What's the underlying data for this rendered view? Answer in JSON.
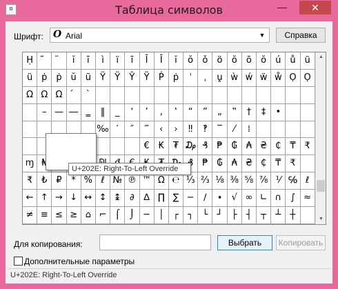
{
  "window": {
    "title": "Таблица символов",
    "app_icon": "¤",
    "minimize_glyph": "—",
    "close_glyph": "✕",
    "accent_color": "#e86a9c",
    "close_color": "#c7474e"
  },
  "font": {
    "label": "Шрифт:",
    "icon_glyph": "O",
    "value": "Arial",
    "dropdown_glyph": "▼"
  },
  "help_button": "Справка",
  "grid": {
    "cells": [
      "Ḥ",
      "̃",
      "̈",
      "ĭ",
      "ī",
      "ì",
      "ï",
      "ī",
      "Ĭ",
      "Ĭ",
      "ĭ",
      "ŏ",
      "ǒ",
      "ö",
      "ŏ",
      "ō",
      "ŏ",
      "ú",
      "ů",
      "ü",
      "ü",
      "ṗ",
      "ṗ",
      "ŭ",
      "ũ",
      "Ÿ",
      "Ÿ",
      "Ŷ",
      "Ÿ",
      "Ṗ",
      "ṗ",
      "ˈ",
      "ˌ",
      "ṷ",
      "ẁ",
      "ẃ",
      "ẅ",
      "ẘ",
      "Ọ",
      "Ọ",
      "Ω",
      "Ω",
      "Ω",
      "́",
      "ˋ",
      "",
      "",
      "",
      "",
      "",
      "",
      "",
      "",
      "",
      "",
      "",
      "",
      "",
      "",
      "",
      "",
      "–",
      "—",
      "―",
      "‗",
      "‖",
      "_",
      "‘",
      "’",
      "‚",
      "‛",
      "“",
      "”",
      "„",
      "‟",
      "†",
      "‡",
      "•",
      "",
      "",
      "",
      "",
      "",
      "",
      "",
      "",
      "",
      "",
      "‰",
      "′",
      "″",
      "‴",
      "‹",
      "›",
      "‼",
      "‽",
      "‾",
      "⁄",
      "⁞",
      "",
      "",
      "",
      "",
      "",
      "",
      "",
      "",
      "",
      "",
      "",
      "",
      "",
      "",
      "",
      "",
      "ɱ",
      "₦",
      "₧",
      "₨",
      "₩",
      "₪",
      "₫",
      "€",
      "₭",
      "₮",
      "₯",
      "₰",
      "₱",
      "₲",
      "₳",
      "₴",
      "₵",
      "₸",
      "₹",
      "",
      "₹",
      "₺",
      "₽",
      "*",
      "%",
      "ℓ",
      "№",
      "℗",
      "™",
      "Ω",
      "℮",
      "⅓",
      "⅔",
      "⅛",
      "⅜",
      "⅝",
      "⅞",
      "⅟",
      "℅",
      "ℓ",
      "←",
      "↑",
      "→",
      "↓",
      "↔",
      "↕",
      "↨",
      "∂",
      "∆",
      "∏",
      "∑",
      "−",
      "∕",
      "∙",
      "√",
      "∞",
      "∟",
      "∩",
      "∫",
      "≈",
      "≠",
      "≡",
      "≤",
      "≥",
      "⌂",
      "⌐",
      "⌠",
      "⌡",
      "─",
      "│",
      "┌",
      "┐",
      "└",
      "┘",
      "├",
      "┤",
      "┬",
      "┴",
      "┼",
      ""
    ],
    "row3_extra": [
      "€",
      "₭",
      "₮",
      "₯",
      "₰",
      "₱",
      "₲",
      "₳",
      "₴",
      "₵",
      "₸",
      "₹"
    ]
  },
  "scroll": {
    "up_glyph": "▲",
    "down_glyph": "▼"
  },
  "tooltip": "U+202E: Right-To-Left Override",
  "copy": {
    "label": "Для копирования:",
    "value": "",
    "select_button": "Выбрать",
    "copy_button": "Копировать"
  },
  "advanced": {
    "label": "Дополнительные параметры",
    "checked": false
  },
  "status": "U+202E: Right-To-Left Override"
}
